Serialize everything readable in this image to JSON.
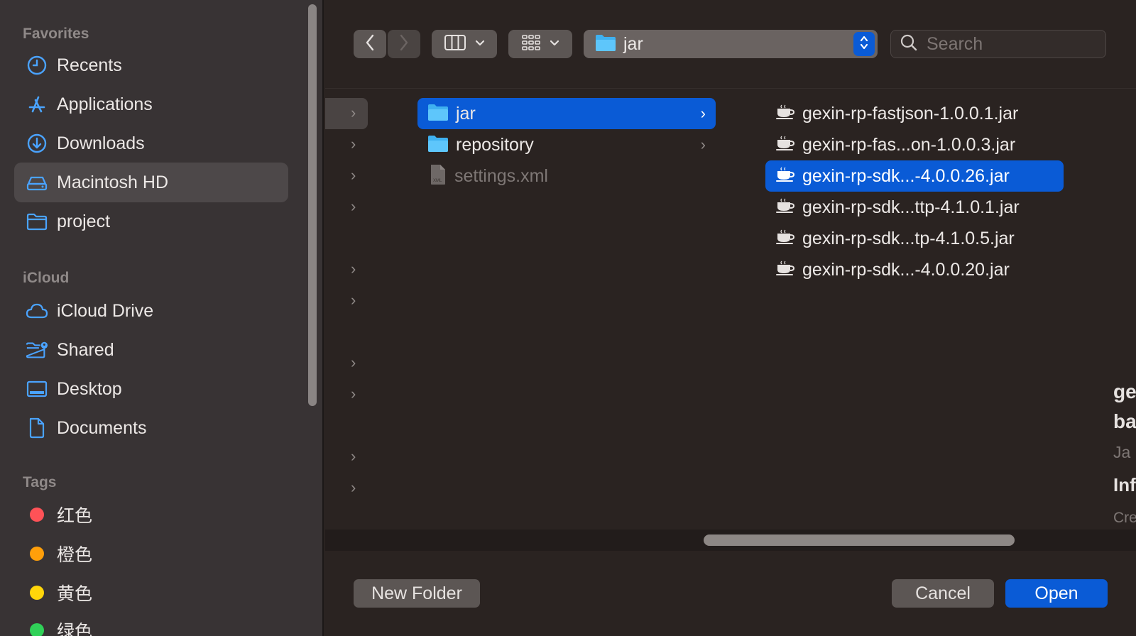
{
  "sidebar": {
    "favorites_title": "Favorites",
    "favorites": [
      {
        "label": "Recents",
        "icon": "clock-icon"
      },
      {
        "label": "Applications",
        "icon": "applications-icon"
      },
      {
        "label": "Downloads",
        "icon": "download-icon"
      },
      {
        "label": "Macintosh HD",
        "icon": "hard-drive-icon",
        "selected": true
      },
      {
        "label": "project",
        "icon": "folder-icon"
      }
    ],
    "icloud_title": "iCloud",
    "icloud": [
      {
        "label": "iCloud Drive",
        "icon": "cloud-icon"
      },
      {
        "label": "Shared",
        "icon": "shared-folder-icon"
      },
      {
        "label": "Desktop",
        "icon": "desktop-icon"
      },
      {
        "label": "Documents",
        "icon": "document-icon"
      }
    ],
    "tags_title": "Tags",
    "tags": [
      {
        "label": "红色",
        "color": "#ff5257"
      },
      {
        "label": "橙色",
        "color": "#ff9f0a"
      },
      {
        "label": "黄色",
        "color": "#ffd60a"
      },
      {
        "label": "绿色",
        "color": "#30d158"
      }
    ]
  },
  "toolbar": {
    "path_label": "jar",
    "search_placeholder": "Search"
  },
  "columns": {
    "col2": [
      {
        "name": "jar",
        "type": "folder",
        "selected": true,
        "has_children": true
      },
      {
        "name": "repository",
        "type": "folder",
        "has_children": true
      },
      {
        "name": "settings.xml",
        "type": "xml",
        "disabled": true
      }
    ],
    "col3": [
      {
        "name": "gexin-rp-fastjson-1.0.0.1.jar"
      },
      {
        "name": "gexin-rp-fas...on-1.0.0.3.jar"
      },
      {
        "name": "gexin-rp-sdk...-4.0.0.26.jar",
        "selected": true
      },
      {
        "name": "gexin-rp-sdk...ttp-4.1.0.1.jar"
      },
      {
        "name": "gexin-rp-sdk...tp-4.1.0.5.jar"
      },
      {
        "name": "gexin-rp-sdk...-4.0.0.20.jar"
      }
    ]
  },
  "preview": {
    "line1": "ge",
    "line2": "ba",
    "line3": "Ja",
    "line4": "Inf",
    "line5": "Cre"
  },
  "buttons": {
    "new_folder": "New Folder",
    "cancel": "Cancel",
    "open": "Open"
  },
  "colors": {
    "accent": "#0a5bd6",
    "sidebar_icon": "#4aa3ff"
  }
}
